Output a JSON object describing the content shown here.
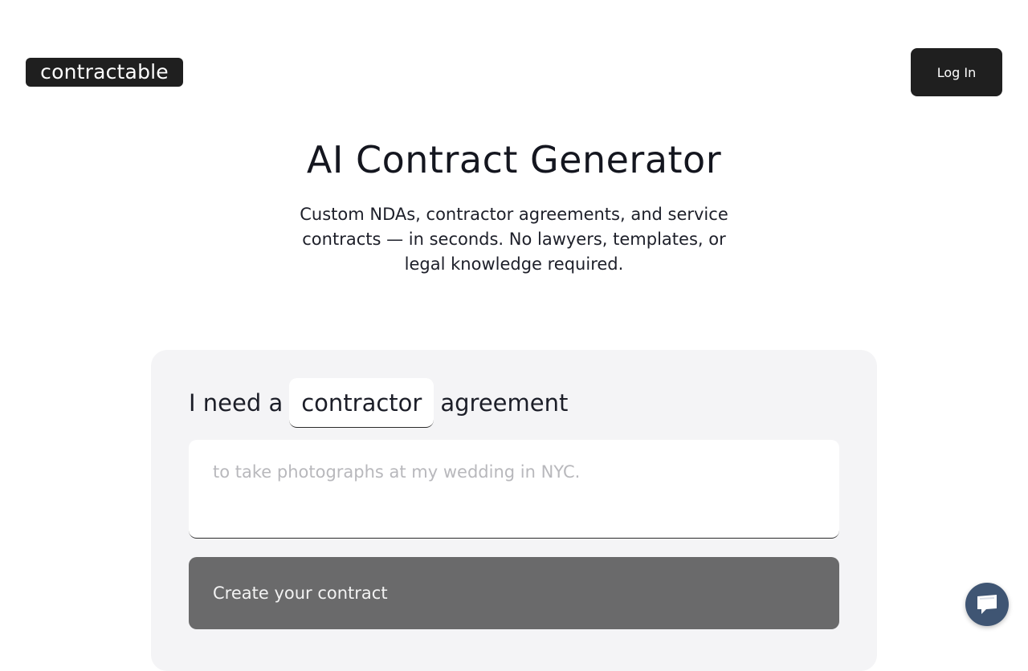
{
  "header": {
    "logo_text": "contractable",
    "login_label": "Log In"
  },
  "hero": {
    "title": "AI Contract Generator",
    "subtitle": "Custom NDAs, contractor agreements, and service contracts — in seconds. No lawyers, templates, or legal knowledge required."
  },
  "form": {
    "prefix": "I need a",
    "contract_type": "contractor",
    "suffix": "agreement",
    "description_value": "",
    "description_placeholder": "to take photographs at my wedding in NYC.",
    "submit_label": "Create your contract"
  },
  "chat_widget": {
    "icon": "chat-icon"
  },
  "colors": {
    "dark": "#1f1f1f",
    "card_bg": "#f4f4f6",
    "button_gray": "#6a6a6b",
    "chat_blue": "#3f5573"
  }
}
